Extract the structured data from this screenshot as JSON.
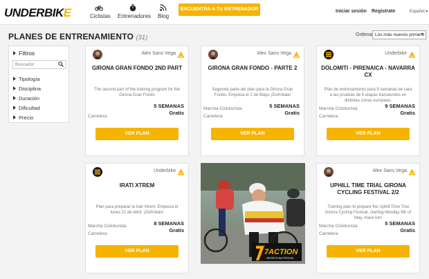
{
  "header": {
    "logo_main": "UNDERBIK",
    "logo_accent": "E",
    "nav": [
      {
        "label": "Ciclistas",
        "icon": "bicycle-icon"
      },
      {
        "label": "Entrenadores",
        "icon": "stopwatch-icon"
      },
      {
        "label": "Blog",
        "icon": "rss-icon"
      }
    ],
    "cta_label": "ENCUENTRA A TU ENTRENADOR",
    "login_label": "Iniciar sesión",
    "register_label": "Registrate",
    "language": "Español"
  },
  "page": {
    "title": "PLANES DE ENTRENAMIENTO",
    "count": "(31)",
    "order_label": "Ordenar",
    "order_value": "Los más nuevos primero"
  },
  "filters": {
    "title": "Filtros",
    "search_placeholder": "Buscador",
    "items": [
      "Tipología",
      "Disciplina",
      "Duración",
      "Dificultad",
      "Precio"
    ]
  },
  "cards": [
    {
      "author": "Alex Sans Vega",
      "title": "GIRONA GRAN FONDO 2ND PART",
      "description": "The second part of the training program for the Girona Gran Fondo",
      "tags": [
        "Carretera"
      ],
      "duration": "5 SEMANAS",
      "price": "Gratis",
      "button": "VER PLAN"
    },
    {
      "author": "Alex Sans Vega",
      "title": "GIRONA GRAN FONDO - PARTE 2",
      "description": "Segunda parte del plan para la Girona Gran Fondo. Empieza el 2 de Mayo ¡Disfrútala!",
      "tags": [
        "Marcha Cicloturista",
        "Carretera"
      ],
      "duration": "5 SEMANAS",
      "price": "Gratis",
      "button": "VER PLAN"
    },
    {
      "author": "Underbike",
      "title": "DOLOMITI - PIRENAICA - NAVARRA CX",
      "description": "Plan de entrenamiento para 9 semanas de cara a las pruebas de 6 etapas transeuntes en distintas zonas europeas.",
      "tags": [
        "Marcha Cicloturista",
        "Carretera"
      ],
      "duration": "9 SEMANAS",
      "price": "Gratis",
      "button": "VER PLAN"
    },
    {
      "author": "Underbike",
      "title": "IRATI XTREM",
      "description": "Plan para preparar la Irati Xtrem. Empieza el lunes 21 de Abril. ¡Disfrútalo!",
      "tags": [
        "Marcha Cicloturista",
        "Carretera"
      ],
      "duration": "8 SEMANAS",
      "price": "Gratis",
      "button": "VER PLAN"
    },
    {
      "author": "Alex Sans Vega",
      "title": "UPHILL TIME TRIAL GIRONA CYCLING FESTIVAL 2/2",
      "description": "Training plan to prepare the Uphill Time Trial Girona Cycling Festival, starting Monday 9th of May. Have fun!",
      "tags": [
        "Marcha Cicloturista",
        "Carretera"
      ],
      "duration": "5 SEMANAS",
      "price": "Gratis",
      "button": "VER PLAN"
    }
  ],
  "ad": {
    "brand_main": "7ACTION",
    "brand_sub": "SPORTS NUTRITION"
  },
  "colors": {
    "accent": "#f6b300",
    "background": "#f3f3f3"
  }
}
